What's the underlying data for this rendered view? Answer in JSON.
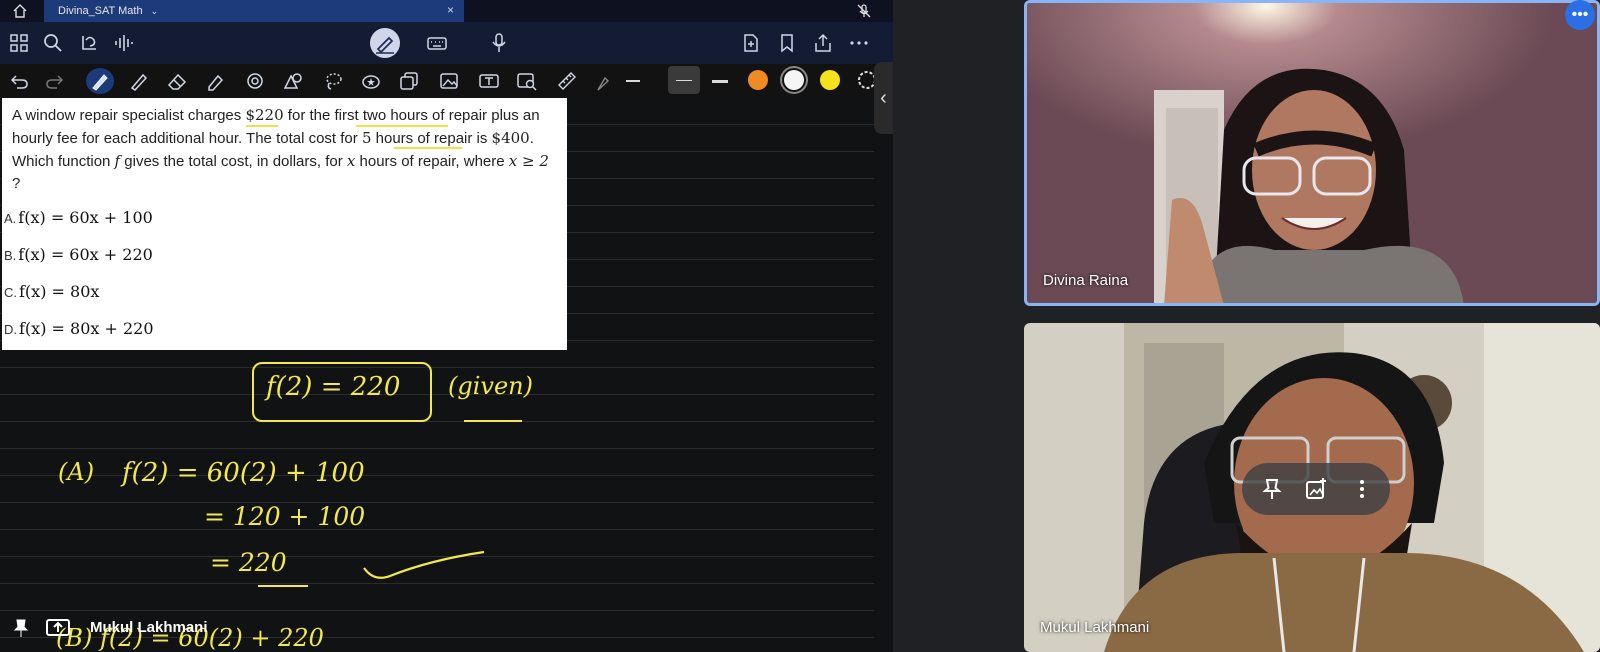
{
  "tab": {
    "title": "Divina_SAT Math",
    "chevron": "⌄",
    "close": "×"
  },
  "question": {
    "stem_parts": {
      "p1": "A window repair specialist charges ",
      "m1": "$220",
      "p2": " for the first two hours of repair plus an hourly fee for each additional hour. The total cost for ",
      "m2": "5",
      "p3": " hours of repair is ",
      "m3": "$400",
      "p4": ". Which function ",
      "m4": "f",
      "p5": " gives the total cost, in dollars, for ",
      "m5": "x",
      "p6": " hours of repair, where ",
      "m6": "x ≥ 2",
      "p7": "?"
    },
    "choices": [
      {
        "letter": "A.",
        "expr": "f(x) = 60x + 100"
      },
      {
        "letter": "B.",
        "expr": "f(x) = 60x + 220"
      },
      {
        "letter": "C.",
        "expr": "f(x) = 80x"
      },
      {
        "letter": "D.",
        "expr": "f(x) = 80x + 220"
      }
    ]
  },
  "handwriting": {
    "boxed": "f(2) = 220",
    "given": "(given)",
    "a_label": "(A)",
    "line1": "f(2) = 60(2) + 100",
    "line2": "= 120 + 100",
    "line3": "= 220",
    "b_partial": "(B)  f(2) =  60(2) + 220"
  },
  "bottom_tag": {
    "name": "Mukul Lakhmani"
  },
  "participants": [
    {
      "name": "Divina Raina"
    },
    {
      "name": "Mukul Lakhmani"
    }
  ],
  "more_button": "•••",
  "colors": {
    "accent_blue": "#8ab4f8",
    "ink_yellow": "#f2e94f",
    "swatch_orange": "#f08a24",
    "swatch_white": "#f5f5f5",
    "swatch_yellow": "#f5e21b"
  }
}
